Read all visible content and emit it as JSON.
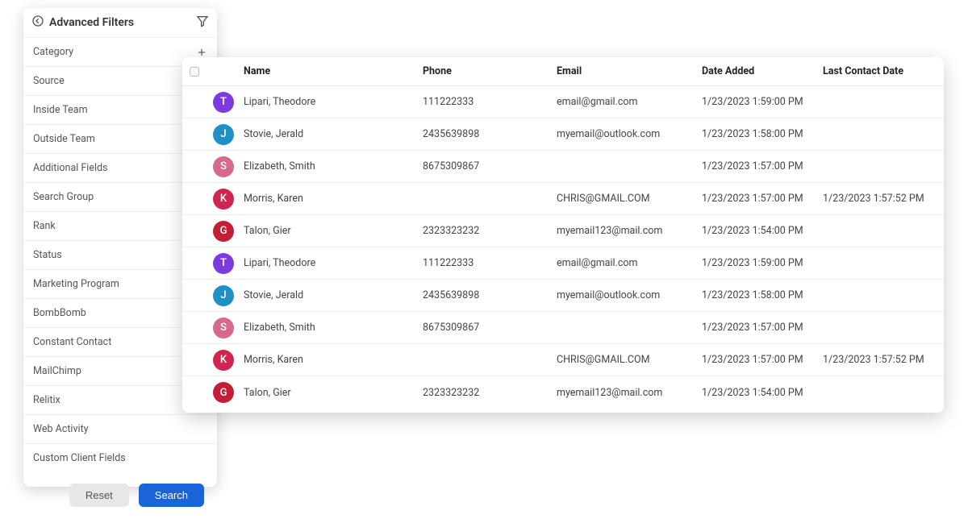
{
  "sidebar": {
    "title": "Advanced Filters",
    "items": [
      {
        "label": "Category",
        "has_plus": true
      },
      {
        "label": "Source"
      },
      {
        "label": "Inside Team"
      },
      {
        "label": "Outside Team"
      },
      {
        "label": "Additional Fields"
      },
      {
        "label": "Search Group"
      },
      {
        "label": "Rank"
      },
      {
        "label": "Status"
      },
      {
        "label": "Marketing Program"
      },
      {
        "label": "BombBomb"
      },
      {
        "label": "Constant Contact"
      },
      {
        "label": "MailChimp"
      },
      {
        "label": "Relitix"
      },
      {
        "label": "Web Activity"
      },
      {
        "label": "Custom Client Fields"
      }
    ],
    "reset_label": "Reset",
    "search_label": "Search"
  },
  "table": {
    "columns": {
      "name": "Name",
      "phone": "Phone",
      "email": "Email",
      "date_added": "Date Added",
      "last_contact": "Last Contact Date"
    },
    "avatar_colors": {
      "T": "#7e3adf",
      "J": "#1f8fc8",
      "S": "#d66a8c",
      "K": "#d02551",
      "G": "#c21e35"
    },
    "rows": [
      {
        "initial": "T",
        "name": "Lipari, Theodore",
        "phone": "111222333",
        "email": "email@gmail.com",
        "date_added": "1/23/2023 1:59:00 PM",
        "last_contact": ""
      },
      {
        "initial": "J",
        "name": "Stovie, Jerald",
        "phone": "2435639898",
        "email": "myemail@outlook.com",
        "date_added": "1/23/2023 1:58:00 PM",
        "last_contact": ""
      },
      {
        "initial": "S",
        "name": "Elizabeth, Smith",
        "phone": "8675309867",
        "email": "",
        "date_added": "1/23/2023 1:57:00 PM",
        "last_contact": ""
      },
      {
        "initial": "K",
        "name": "Morris, Karen",
        "phone": "",
        "email": "CHRIS@GMAIL.COM",
        "date_added": "1/23/2023 1:57:00 PM",
        "last_contact": "1/23/2023 1:57:52 PM"
      },
      {
        "initial": "G",
        "name": "Talon, Gier",
        "phone": "2323323232",
        "email": "myemail123@mail.com",
        "date_added": "1/23/2023 1:54:00 PM",
        "last_contact": ""
      },
      {
        "initial": "T",
        "name": "Lipari, Theodore",
        "phone": "111222333",
        "email": "email@gmail.com",
        "date_added": "1/23/2023 1:59:00 PM",
        "last_contact": ""
      },
      {
        "initial": "J",
        "name": "Stovie, Jerald",
        "phone": "2435639898",
        "email": "myemail@outlook.com",
        "date_added": "1/23/2023 1:58:00 PM",
        "last_contact": ""
      },
      {
        "initial": "S",
        "name": "Elizabeth, Smith",
        "phone": "8675309867",
        "email": "",
        "date_added": "1/23/2023 1:57:00 PM",
        "last_contact": ""
      },
      {
        "initial": "K",
        "name": "Morris, Karen",
        "phone": "",
        "email": "CHRIS@GMAIL.COM",
        "date_added": "1/23/2023 1:57:00 PM",
        "last_contact": "1/23/2023 1:57:52 PM"
      },
      {
        "initial": "G",
        "name": "Talon, Gier",
        "phone": "2323323232",
        "email": "myemail123@mail.com",
        "date_added": "1/23/2023 1:54:00 PM",
        "last_contact": ""
      }
    ]
  }
}
